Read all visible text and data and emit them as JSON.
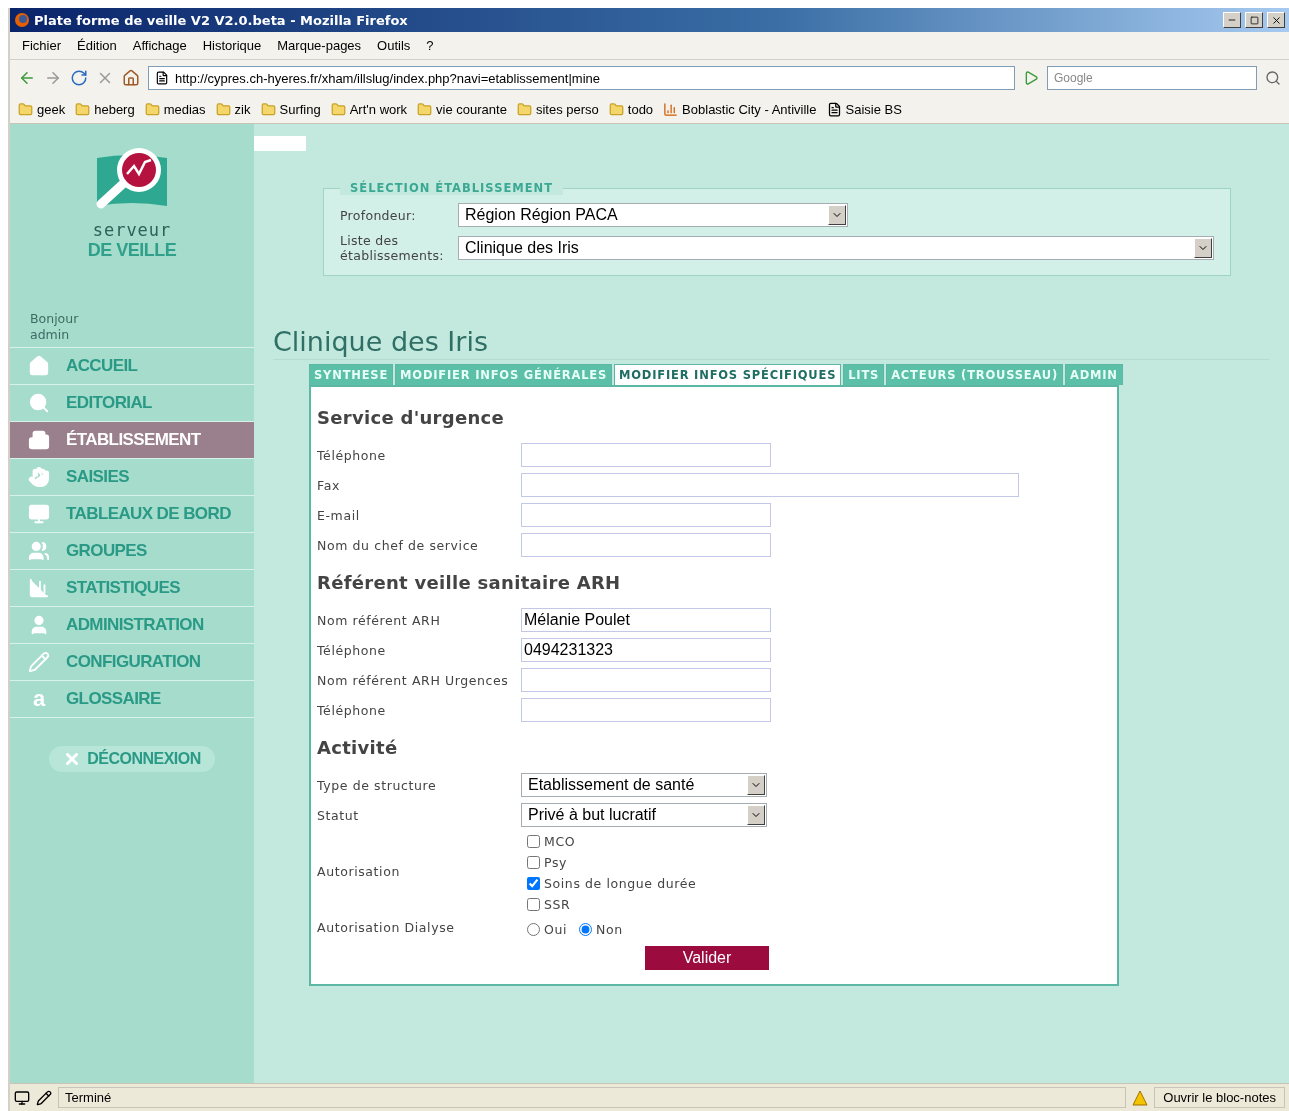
{
  "window": {
    "title": "Plate forme de veille V2 V2.0.beta - Mozilla Firefox"
  },
  "menu": [
    "Fichier",
    "Édition",
    "Affichage",
    "Historique",
    "Marque-pages",
    "Outils",
    "?"
  ],
  "address_bar": {
    "url": "http://cypres.ch-hyeres.fr/xham/illslug/index.php?navi=etablissement|mine"
  },
  "search": {
    "placeholder": "Google"
  },
  "bookmarks": [
    {
      "label": "geek",
      "kind": "folder"
    },
    {
      "label": "heberg",
      "kind": "folder"
    },
    {
      "label": "medias",
      "kind": "folder"
    },
    {
      "label": "zik",
      "kind": "folder"
    },
    {
      "label": "Surfing",
      "kind": "folder"
    },
    {
      "label": "Art'n work",
      "kind": "folder"
    },
    {
      "label": "vie courante",
      "kind": "folder"
    },
    {
      "label": "sites perso",
      "kind": "folder"
    },
    {
      "label": "todo",
      "kind": "folder"
    },
    {
      "label": "Boblastic City - Antiville",
      "kind": "chart"
    },
    {
      "label": "Saisie BS",
      "kind": "page"
    }
  ],
  "sidebar": {
    "logo": {
      "line1": "serveur",
      "line2": "DE VEILLE"
    },
    "greeting": "Bonjour admin",
    "items": [
      {
        "label": "ACCUEIL",
        "selected": false
      },
      {
        "label": "EDITORIAL",
        "selected": false
      },
      {
        "label": "ÉTABLISSEMENT",
        "selected": true
      },
      {
        "label": "SAISIES",
        "selected": false
      },
      {
        "label": "TABLEAUX DE BORD",
        "selected": false
      },
      {
        "label": "GROUPES",
        "selected": false
      },
      {
        "label": "STATISTIQUES",
        "selected": false
      },
      {
        "label": "ADMINISTRATION",
        "selected": false
      },
      {
        "label": "CONFIGURATION",
        "selected": false
      },
      {
        "label": "GLOSSAIRE",
        "selected": false,
        "glyph": "a"
      }
    ],
    "logout": "DÉCONNEXION"
  },
  "selection": {
    "legend": "SÉLECTION ÉTABLISSEMENT",
    "fields": [
      {
        "label": "Profondeur:",
        "value": "Région Région PACA",
        "kind": "short"
      },
      {
        "label": "Liste des établissements:",
        "value": "Clinique des Iris",
        "kind": "long"
      }
    ]
  },
  "page_title": "Clinique des Iris",
  "tabs": [
    {
      "label": "SYNTHESE",
      "selected": false
    },
    {
      "label": "MODIFIER INFOS GÉNÉRALES",
      "selected": false
    },
    {
      "label": "MODIFIER INFOS SPÉCIFIQUES",
      "selected": true
    },
    {
      "label": "LITS",
      "selected": false
    },
    {
      "label": "ACTEURS (TROUSSEAU)",
      "selected": false
    },
    {
      "label": "ADMIN",
      "selected": false
    }
  ],
  "sections": [
    {
      "heading": "Service d'urgence",
      "fields": [
        {
          "kind": "text",
          "label": "Téléphone"
        },
        {
          "kind": "wide_text",
          "label": "Fax"
        },
        {
          "kind": "text",
          "label": "E-mail"
        },
        {
          "kind": "text",
          "label": "Nom du chef de service"
        }
      ]
    },
    {
      "heading": "Référent veille sanitaire ARH",
      "fields": [
        {
          "kind": "text",
          "label": "Nom référent ARH",
          "value": "Mélanie Poulet"
        },
        {
          "kind": "text",
          "label": "Téléphone",
          "value": "0494231323"
        },
        {
          "kind": "text",
          "label": "Nom référent ARH Urgences"
        },
        {
          "kind": "text",
          "label": "Téléphone"
        }
      ]
    },
    {
      "heading": "Activité",
      "fields": [
        {
          "kind": "select",
          "label": "Type de structure",
          "value": "Etablissement de santé"
        },
        {
          "kind": "select",
          "label": "Statut",
          "value": "Privé à but lucratif"
        },
        {
          "kind": "checkboxes",
          "label": "Autorisation",
          "options": [
            {
              "label": "MCO",
              "checked": false
            },
            {
              "label": "Psy",
              "checked": false
            },
            {
              "label": "Soins de longue durée",
              "checked": true
            },
            {
              "label": "SSR",
              "checked": false
            }
          ]
        },
        {
          "kind": "radios",
          "label": "Autorisation Dialyse",
          "options": [
            {
              "label": "Oui",
              "selected": false
            },
            {
              "label": "Non",
              "selected": true
            }
          ]
        }
      ]
    }
  ],
  "submit": "Valider",
  "status_bar": {
    "text": "Terminé",
    "notepad": "Ouvrir le bloc-notes"
  }
}
